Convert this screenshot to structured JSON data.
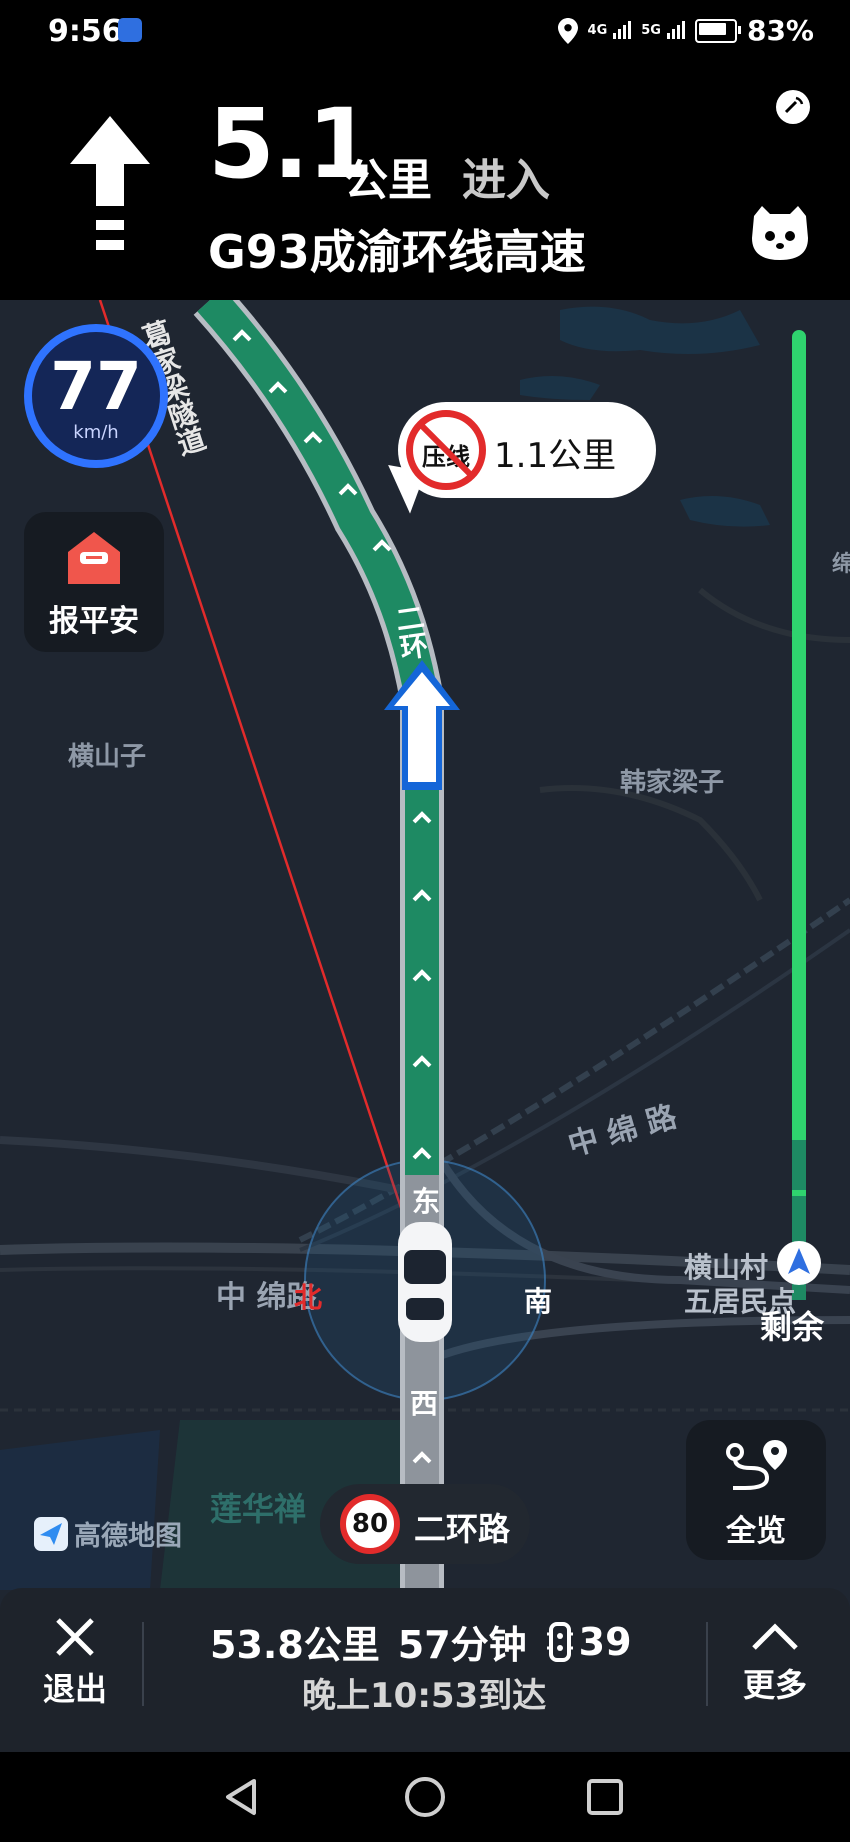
{
  "status_bar": {
    "time": "9:56",
    "network_1": "4G",
    "network_2": "5G",
    "battery": "83%"
  },
  "guidance": {
    "distance_value": "5.1",
    "distance_unit": "公里",
    "action": "进入",
    "road_name": "G93成渝环线高速",
    "current_road_label": "葛家梁隧道",
    "turn_icon": "straight-arrow-icon"
  },
  "map": {
    "current_speed": "77",
    "speed_unit": "km/h",
    "safe_button_label": "报平安",
    "camera_alert": {
      "sign_text": "压线",
      "distance": "1.1公里"
    },
    "route_road_label": "二环",
    "place_labels": {
      "hengshanzi": "横山子",
      "hanjialiangzi": "韩家梁子",
      "zhongmianlu_right": "中 绵 路",
      "zhongmianlu_left": "中 绵路",
      "hengshancun_1": "横山村",
      "hengshancun_2": "五居民点",
      "lianhua": "莲华禅",
      "partial_right": "绵"
    },
    "compass": {
      "east": "东",
      "west": "西",
      "south": "南",
      "north": "北"
    },
    "speed_limit": "80",
    "speed_limit_road": "二环路",
    "overview_label": "全览",
    "logo_text": "高德地图",
    "remaining_label": "剩余",
    "colors": {
      "route_green": "#1e8a63",
      "progress_green": "#2fd36e",
      "speed_ring": "#2f73ff",
      "alert_red": "#e22b2b"
    }
  },
  "trip_summary": {
    "distance": "53.8公里",
    "duration": "57分钟",
    "traffic_lights": "39",
    "arrival": "晚上10:53到达",
    "exit_label": "退出",
    "more_label": "更多"
  }
}
